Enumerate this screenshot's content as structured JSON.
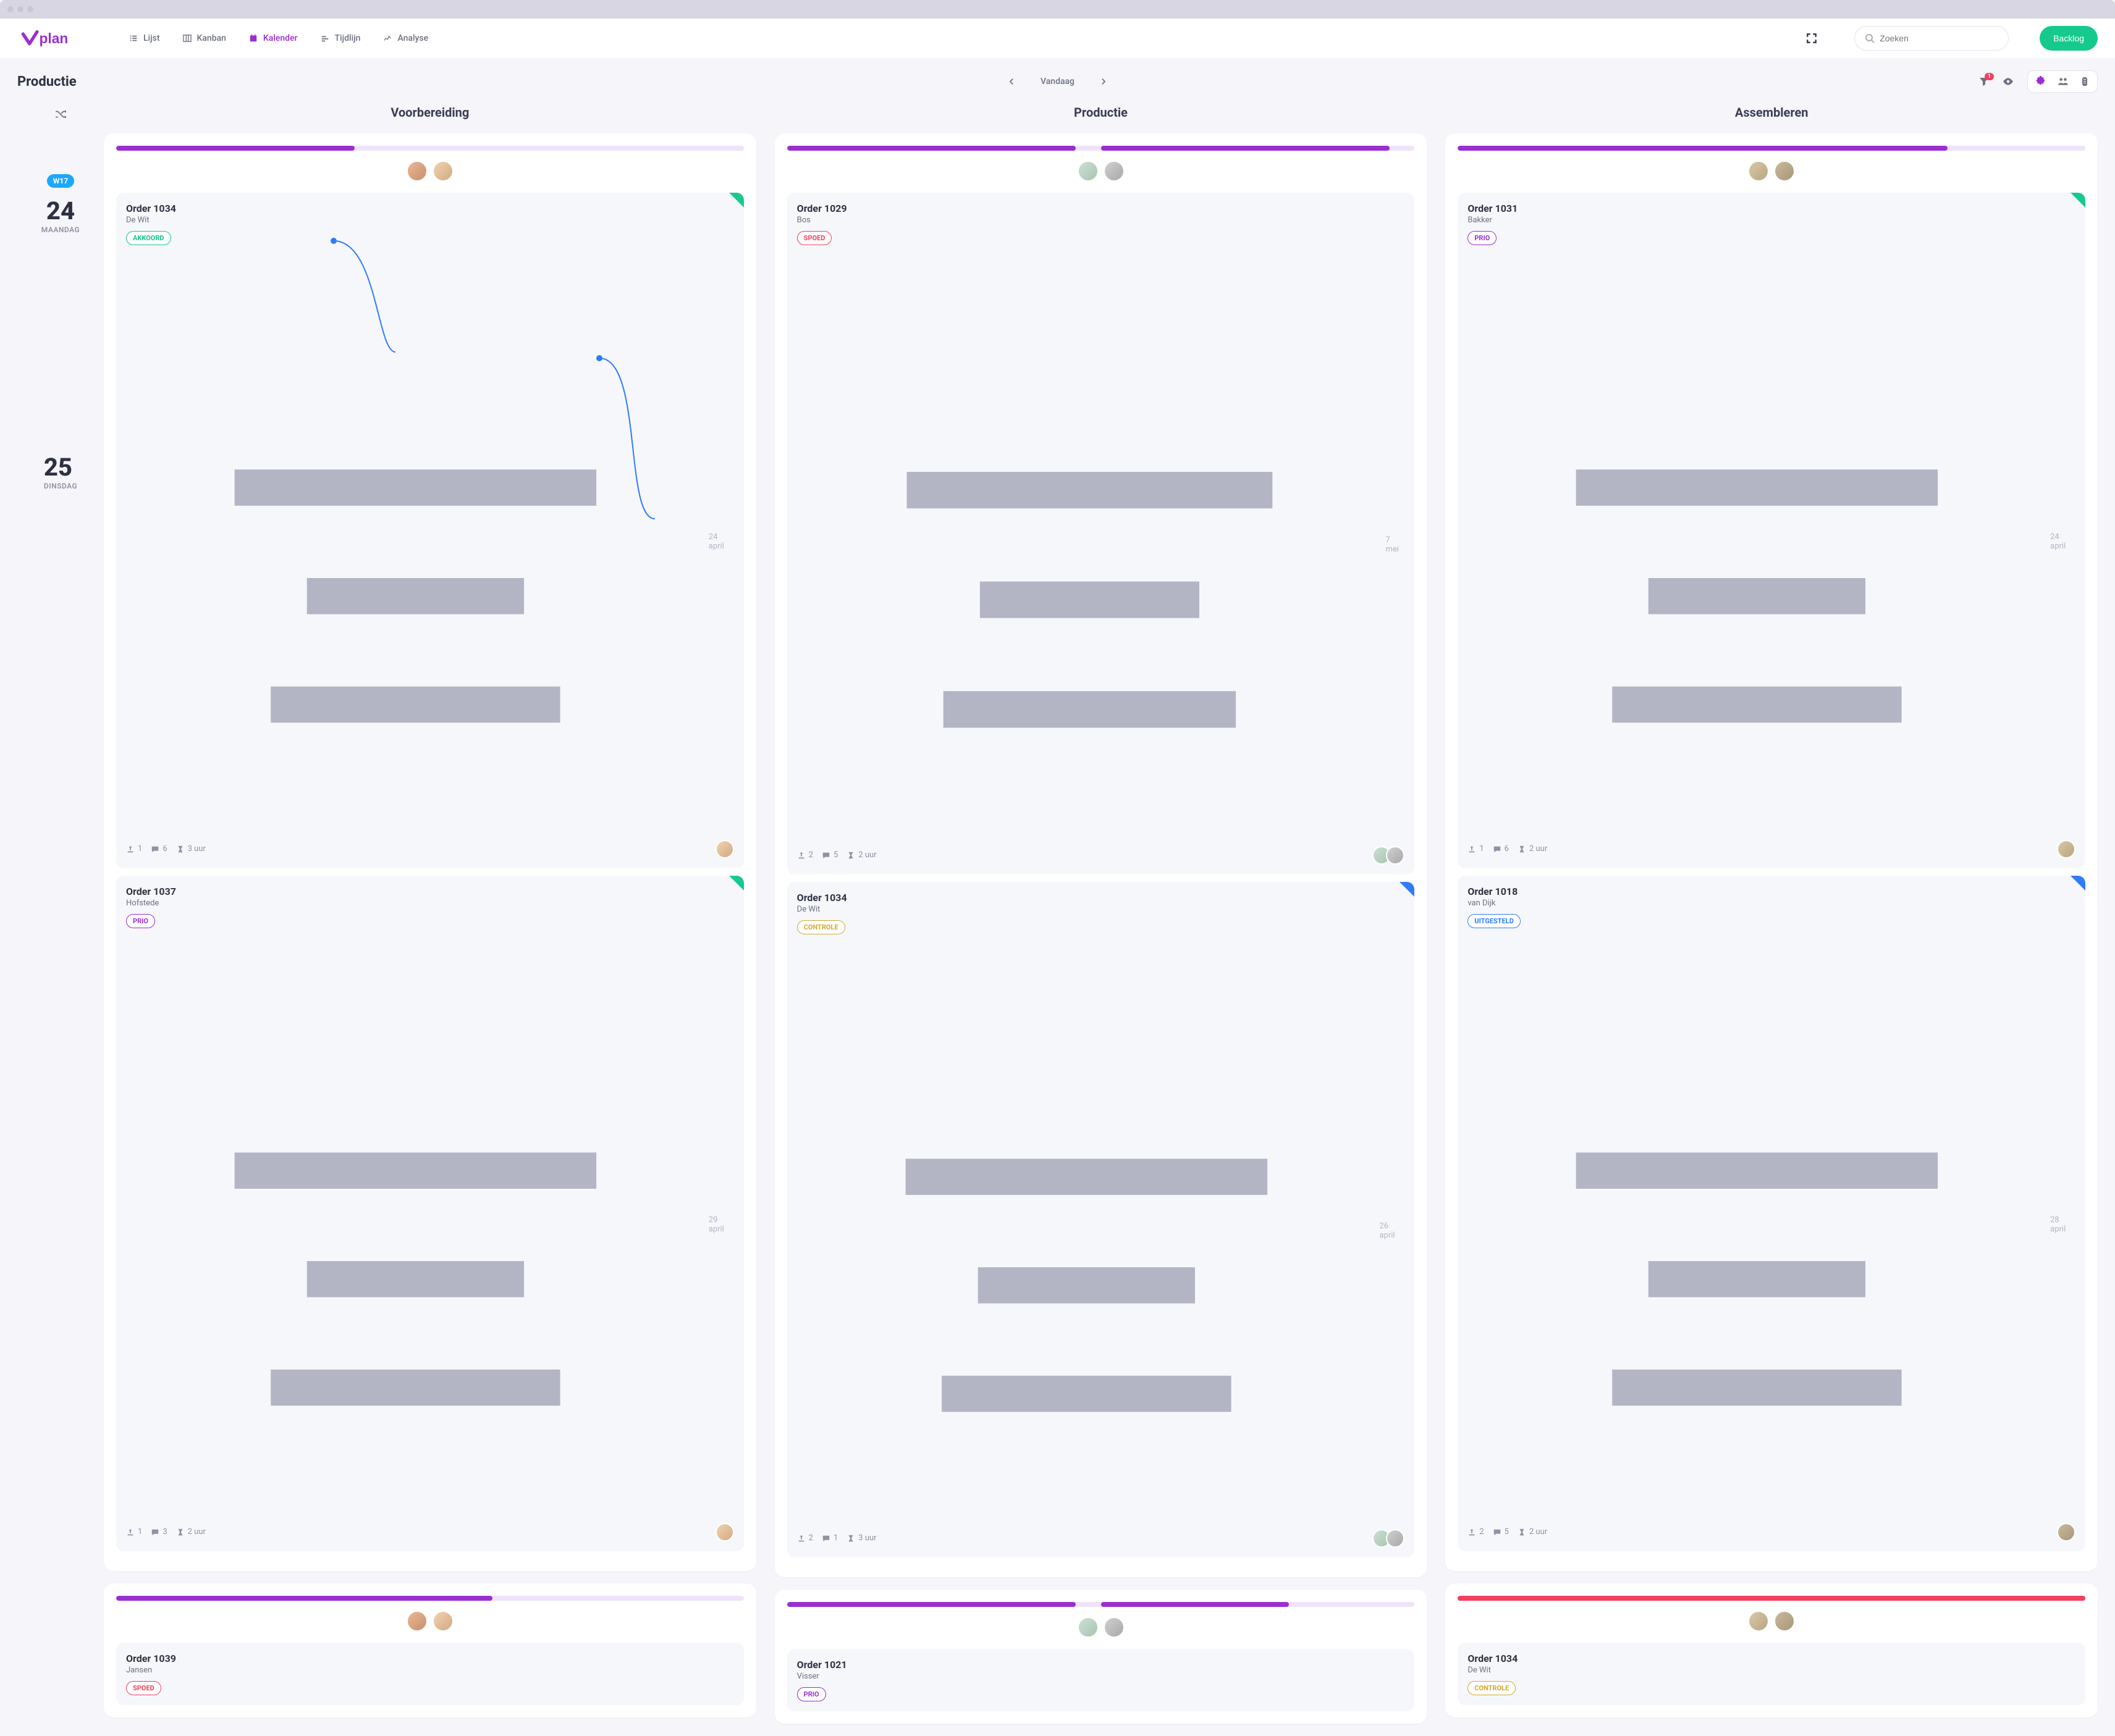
{
  "logo_text": "plan",
  "nav": {
    "lijst": "Lijst",
    "kanban": "Kanban",
    "kalender": "Kalender",
    "tijdlijn": "Tijdlijn",
    "analyse": "Analyse"
  },
  "search": {
    "placeholder": "Zoeken"
  },
  "backlog_label": "Backlog",
  "page_title": "Productie",
  "today_label": "Vandaag",
  "filter_badge": "1",
  "columns": {
    "voorbereiding": "Voorbereiding",
    "productie": "Productie",
    "assembleren": "Assembleren"
  },
  "week_badge": "W17",
  "day1": {
    "num": "24",
    "name": "MAANDAG"
  },
  "day2": {
    "num": "25",
    "name": "DINSDAG"
  },
  "cards": {
    "c1": {
      "title": "Order 1034",
      "sub": "De Wit",
      "tag": "AKKOORD",
      "date": "24 april",
      "s1": "1",
      "s2": "6",
      "s3": "3 uur"
    },
    "c2": {
      "title": "Order 1037",
      "sub": "Hofstede",
      "tag": "PRIO",
      "date": "29 april",
      "s1": "1",
      "s2": "3",
      "s3": "2 uur"
    },
    "c3": {
      "title": "Order 1029",
      "sub": "Bos",
      "tag": "SPOED",
      "date": "7 mei",
      "s1": "2",
      "s2": "5",
      "s3": "2 uur"
    },
    "c4": {
      "title": "Order 1034",
      "sub": "De Wit",
      "tag": "CONTROLE",
      "date": "26 april",
      "s1": "2",
      "s2": "1",
      "s3": "3 uur"
    },
    "c5": {
      "title": "Order 1031",
      "sub": "Bakker",
      "tag": "PRIO",
      "date": "24 april",
      "s1": "1",
      "s2": "6",
      "s3": "2 uur"
    },
    "c6": {
      "title": "Order 1018",
      "sub": "van Dijk",
      "tag": "UITGESTELD",
      "date": "28 april",
      "s1": "2",
      "s2": "5",
      "s3": "2 uur"
    },
    "c7": {
      "title": "Order 1039",
      "sub": "Jansen",
      "tag": "SPOED"
    },
    "c8": {
      "title": "Order 1021",
      "sub": "Visser",
      "tag": "PRIO"
    },
    "c9": {
      "title": "Order 1034",
      "sub": "De Wit",
      "tag": "CONTROLE"
    }
  }
}
